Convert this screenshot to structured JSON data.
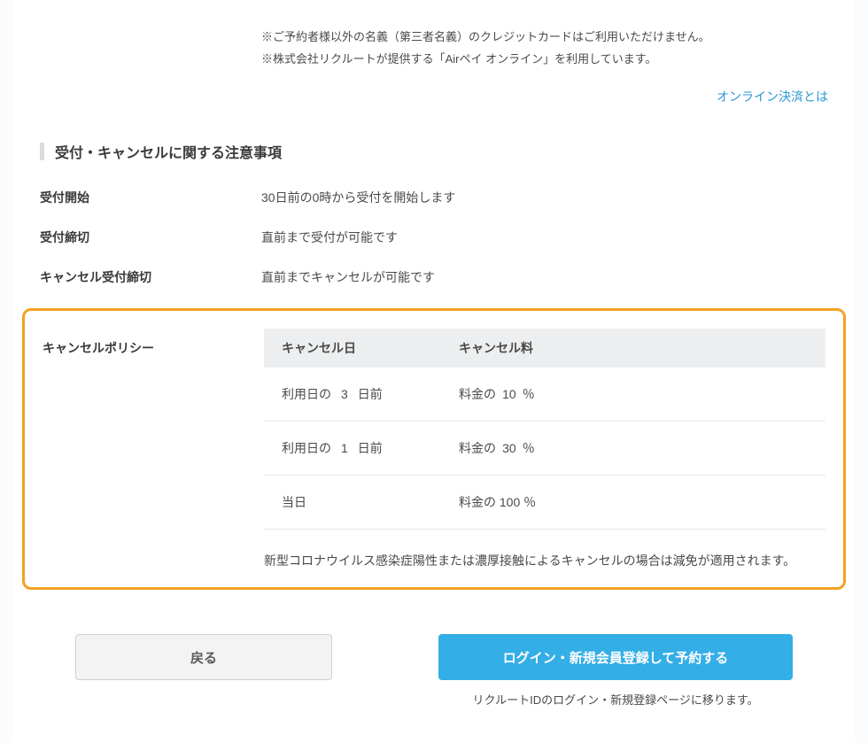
{
  "notes": {
    "line1": "※ご予約者様以外の名義（第三者名義）のクレジットカードはご利用いただけません。",
    "line2": "※株式会社リクルートが提供する「Airペイ オンライン」を利用しています。"
  },
  "online_link": "オンライン決済とは",
  "section_title": "受付・キャンセルに関する注意事項",
  "fields": {
    "start": {
      "label": "受付開始",
      "value": "30日前の0時から受付を開始します"
    },
    "deadline": {
      "label": "受付締切",
      "value": "直前まで受付が可能です"
    },
    "cancel_deadline": {
      "label": "キャンセル受付締切",
      "value": "直前までキャンセルが可能です"
    },
    "policy_label": "キャンセルポリシー"
  },
  "policy": {
    "headers": {
      "day": "キャンセル日",
      "fee": "キャンセル料"
    },
    "rows": [
      {
        "day_prefix": "利用日の",
        "day_num": "3",
        "day_suffix": "日前",
        "fee_prefix": "料金の",
        "fee_num": "10",
        "fee_suffix": "％"
      },
      {
        "day_prefix": "利用日の",
        "day_num": "1",
        "day_suffix": "日前",
        "fee_prefix": "料金の",
        "fee_num": "30",
        "fee_suffix": "％"
      },
      {
        "day_prefix": "当日",
        "day_num": "",
        "day_suffix": "",
        "fee_prefix": "料金の",
        "fee_num": "100",
        "fee_suffix": "％"
      }
    ],
    "note": "新型コロナウイルス感染症陽性または濃厚接触によるキャンセルの場合は減免が適用されます。"
  },
  "buttons": {
    "back": "戻る",
    "login_reserve": "ログイン・新規会員登録して予約する",
    "recruit_note": "リクルートIDのログイン・新規登録ページに移ります。"
  }
}
